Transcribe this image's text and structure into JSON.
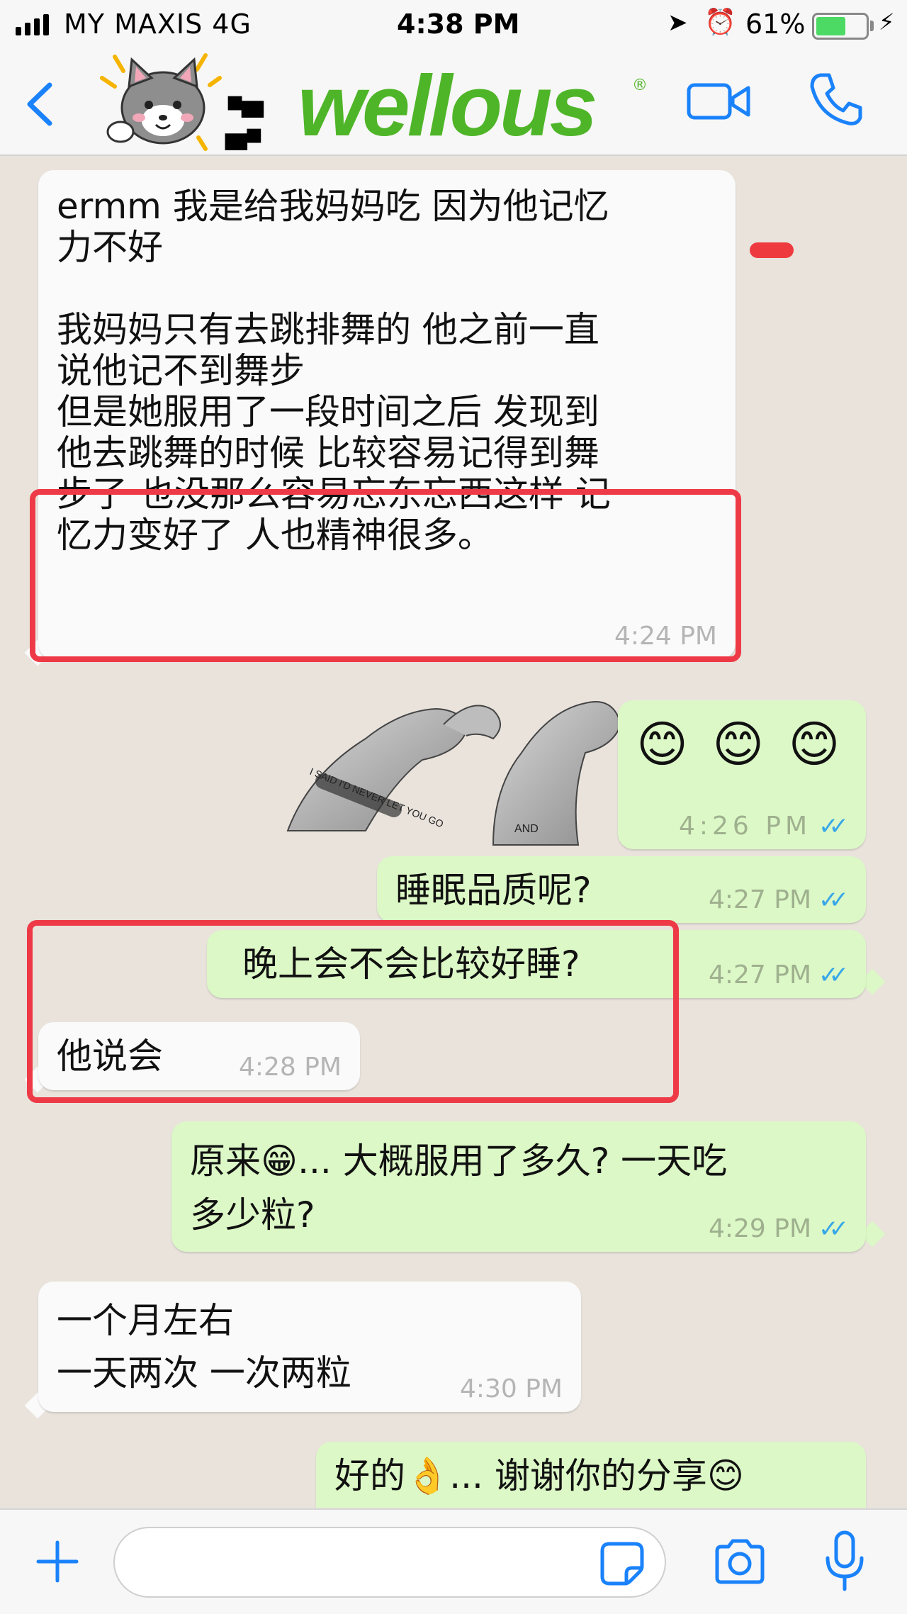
{
  "status_bar": {
    "carrier": "MY MAXIS  4G",
    "time": "4:38 PM",
    "battery_percent": "61%",
    "battery_level": 0.61
  },
  "header": {
    "contact_name": "▪▄ ▄▪",
    "brand_logo": "wellous",
    "brand_mark": "®",
    "icons": [
      "back-icon",
      "video-call-icon",
      "voice-call-icon"
    ]
  },
  "messages": [
    {
      "direction": "in",
      "text": "ermm 我是给我妈妈吃 因为他记忆\n力不好\n\n我妈妈只有去跳排舞的 他之前一直\n说他记不到舞步\n但是她服用了一段时间之后 发现到\n他去跳舞的时候 比较容易记得到舞\n步了 也没那么容易忘东忘西这样 记\n忆力变好了 人也精神很多。",
      "time": "4:24 PM"
    },
    {
      "direction": "out",
      "text": "😊 😊 😊",
      "time": "4:26 PM",
      "read": "✓✓"
    },
    {
      "direction": "out",
      "text": "睡眠品质呢?",
      "time": "4:27 PM",
      "read": "✓✓"
    },
    {
      "direction": "out",
      "text": "晚上会不会比较好睡?",
      "time": "4:27 PM",
      "read": "✓✓"
    },
    {
      "direction": "in",
      "text": "他说会",
      "time": "4:28 PM"
    },
    {
      "direction": "out",
      "text": "原来😁... 大概服用了多久? 一天吃\n多少粒?",
      "time": "4:29 PM",
      "read": "✓✓"
    },
    {
      "direction": "in",
      "text": "一个月左右\n一天两次 一次两粒",
      "time": "4:30 PM"
    },
    {
      "direction": "out",
      "text": "好的👌... 谢谢你的分享😊",
      "time": "",
      "read": ""
    }
  ],
  "sketch": {
    "wristband_text": "I SAID I'D NEVER LET YOU GO",
    "band_text": "AND"
  },
  "composer": {
    "value": "",
    "icons": [
      "plus-icon",
      "sticker-icon",
      "camera-icon",
      "microphone-icon"
    ]
  },
  "colors": {
    "accent_blue": "#1a82fb",
    "outgoing_bubble": "#dcf8c6",
    "incoming_bubble": "#fafafa",
    "highlight_red": "#ee3a46",
    "brand_green": "#4fb528",
    "read_tick_blue": "#37a7e8"
  }
}
